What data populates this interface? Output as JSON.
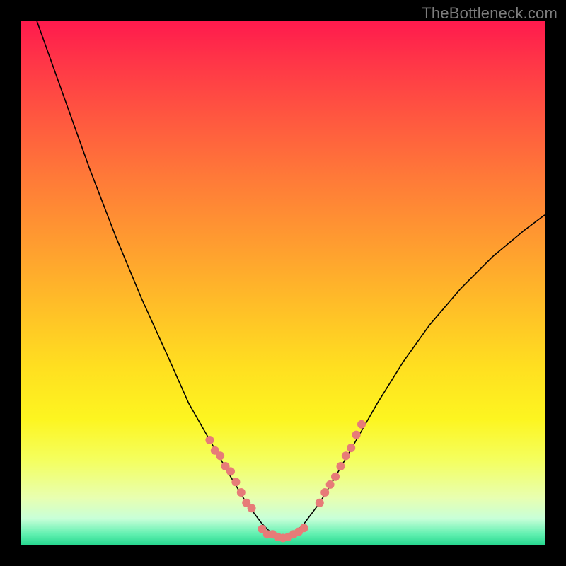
{
  "watermark": "TheBottleneck.com",
  "colors": {
    "dot": "#e77b78",
    "curve": "#000000",
    "frame_bg_top": "#ff1a4d",
    "frame_bg_bottom": "#28d890",
    "page_bg": "#000000"
  },
  "chart_data": {
    "type": "line",
    "title": "",
    "xlabel": "",
    "ylabel": "",
    "xlim": [
      0,
      100
    ],
    "ylim": [
      0,
      100
    ],
    "grid": false,
    "legend": false,
    "series": [
      {
        "name": "bottleneck-curve",
        "x": [
          3,
          8,
          13,
          18,
          23,
          28,
          32,
          36,
          40,
          43,
          46,
          48,
          50,
          52,
          54,
          57,
          60,
          64,
          68,
          73,
          78,
          84,
          90,
          96,
          100
        ],
        "y": [
          100,
          86,
          72,
          59,
          47,
          36,
          27,
          20,
          13,
          8,
          4,
          2,
          1,
          2,
          4,
          8,
          13,
          20,
          27,
          35,
          42,
          49,
          55,
          60,
          63
        ]
      }
    ],
    "points": [
      {
        "name": "left-cluster",
        "coords": [
          {
            "x": 36,
            "y": 20
          },
          {
            "x": 37,
            "y": 18
          },
          {
            "x": 38,
            "y": 17
          },
          {
            "x": 39,
            "y": 15
          },
          {
            "x": 40,
            "y": 14
          },
          {
            "x": 41,
            "y": 12
          },
          {
            "x": 42,
            "y": 10
          },
          {
            "x": 43,
            "y": 8
          },
          {
            "x": 44,
            "y": 7
          }
        ]
      },
      {
        "name": "bottom-cluster",
        "coords": [
          {
            "x": 46,
            "y": 3
          },
          {
            "x": 47,
            "y": 2
          },
          {
            "x": 48,
            "y": 2
          },
          {
            "x": 49,
            "y": 1.5
          },
          {
            "x": 50,
            "y": 1.3
          },
          {
            "x": 51,
            "y": 1.5
          },
          {
            "x": 52,
            "y": 2
          },
          {
            "x": 53,
            "y": 2.5
          },
          {
            "x": 54,
            "y": 3.2
          }
        ]
      },
      {
        "name": "right-cluster",
        "coords": [
          {
            "x": 57,
            "y": 8
          },
          {
            "x": 58,
            "y": 10
          },
          {
            "x": 59,
            "y": 11.5
          },
          {
            "x": 60,
            "y": 13
          },
          {
            "x": 61,
            "y": 15
          },
          {
            "x": 62,
            "y": 17
          },
          {
            "x": 63,
            "y": 18.5
          },
          {
            "x": 64,
            "y": 21
          },
          {
            "x": 65,
            "y": 23
          }
        ]
      }
    ]
  }
}
